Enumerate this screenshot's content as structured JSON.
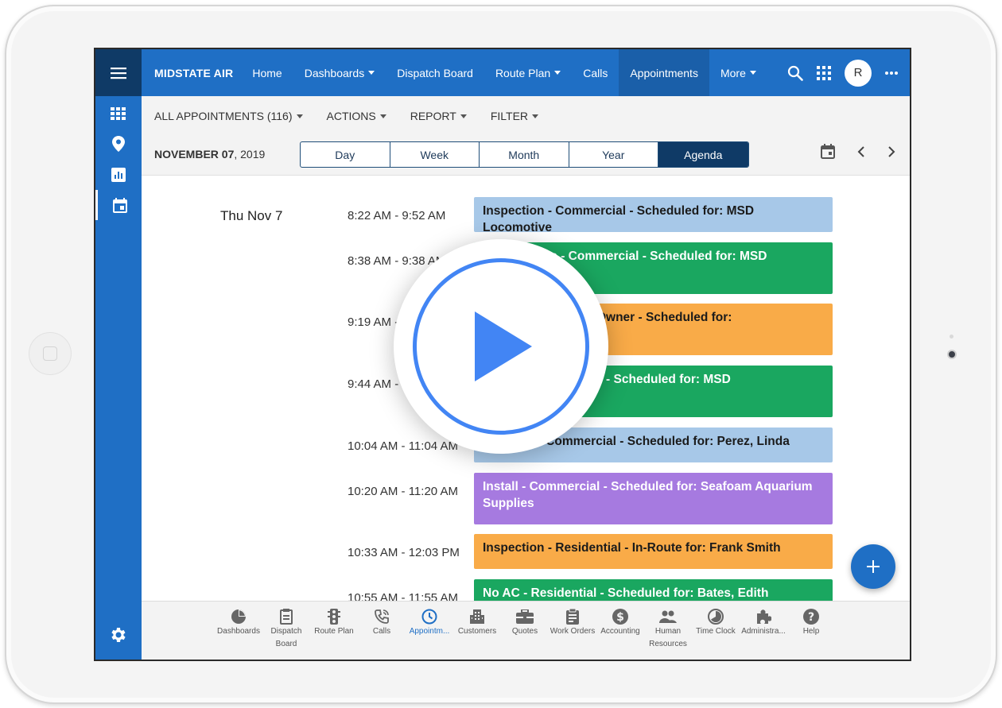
{
  "brand": "MIDSTATE AIR",
  "nav": {
    "items": [
      {
        "label": "Home",
        "has_caret": false
      },
      {
        "label": "Dashboards",
        "has_caret": true
      },
      {
        "label": "Dispatch Board",
        "has_caret": false
      },
      {
        "label": "Route Plan",
        "has_caret": true
      },
      {
        "label": "Calls",
        "has_caret": false
      },
      {
        "label": "Appointments",
        "has_caret": false,
        "active": true
      },
      {
        "label": "More",
        "has_caret": true
      }
    ],
    "avatar_initial": "R"
  },
  "toolbar": {
    "all_appointments": "ALL APPOINTMENTS (116)",
    "actions": "ACTIONS",
    "report": "REPORT",
    "filter": "FILTER",
    "date_bold": "NOVEMBER 07",
    "date_rest": ", 2019",
    "view_tabs": [
      "Day",
      "Week",
      "Month",
      "Year",
      "Agenda"
    ],
    "active_view": "Agenda"
  },
  "agenda": {
    "day_label": "Thu Nov 7",
    "appointments": [
      {
        "time": "8:22 AM - 9:52 AM",
        "title": "Inspection - Commercial - Scheduled for: MSD Locomotive",
        "color": "#a7c8e8",
        "text_color": "#1b1b1b"
      },
      {
        "time": "8:38 AM - 9:38 AM",
        "title": "Maintenance - Commercial - Scheduled for: MSD",
        "color": "#1aa760",
        "text_color": "#ffffff"
      },
      {
        "time": "9:19 AM - 10:19 AM",
        "title": "Installation - Home Owner - Scheduled for:",
        "color": "#f9ab48",
        "text_color": "#1b1b1b"
      },
      {
        "time": "9:44 AM - 10:44 AM",
        "title": "Repair - Commercial - Scheduled for: MSD",
        "color": "#1aa760",
        "text_color": "#ffffff"
      },
      {
        "time": "10:04 AM - 11:04 AM",
        "title": "Cleaning - Commercial - Scheduled for: Perez, Linda",
        "color": "#a7c8e8",
        "text_color": "#1b1b1b"
      },
      {
        "time": "10:20 AM - 11:20 AM",
        "title": "Install - Commercial - Scheduled for: Seafoam Aquarium Supplies",
        "color": "#a67ae0",
        "text_color": "#ffffff"
      },
      {
        "time": "10:33 AM - 12:03 PM",
        "title": "Inspection - Residential - In-Route for: Frank Smith",
        "color": "#f9ab48",
        "text_color": "#1b1b1b"
      },
      {
        "time": "10:55 AM - 11:55 AM",
        "title": "No AC - Residential - Scheduled for: Bates, Edith",
        "color": "#1aa760",
        "text_color": "#ffffff"
      }
    ]
  },
  "bottom_nav": [
    {
      "label": "Dashboards",
      "icon": "pie-chart-icon"
    },
    {
      "label": "Dispatch Board",
      "icon": "clipboard-icon"
    },
    {
      "label": "Route Plan",
      "icon": "traffic-light-icon"
    },
    {
      "label": "Calls",
      "icon": "phone-icon"
    },
    {
      "label": "Appointm...",
      "icon": "clock-icon",
      "active": true
    },
    {
      "label": "Customers",
      "icon": "building-icon"
    },
    {
      "label": "Quotes",
      "icon": "briefcase-icon"
    },
    {
      "label": "Work Orders",
      "icon": "clipboard-list-icon"
    },
    {
      "label": "Accounting",
      "icon": "dollar-icon"
    },
    {
      "label": "Human Resources",
      "icon": "people-icon"
    },
    {
      "label": "Time Clock",
      "icon": "time-clock-icon"
    },
    {
      "label": "Administra...",
      "icon": "puzzle-icon"
    },
    {
      "label": "Help",
      "icon": "help-icon"
    }
  ],
  "colors": {
    "primary": "#1f6fc5",
    "dark": "#0f3a66",
    "play": "#4285f4"
  }
}
